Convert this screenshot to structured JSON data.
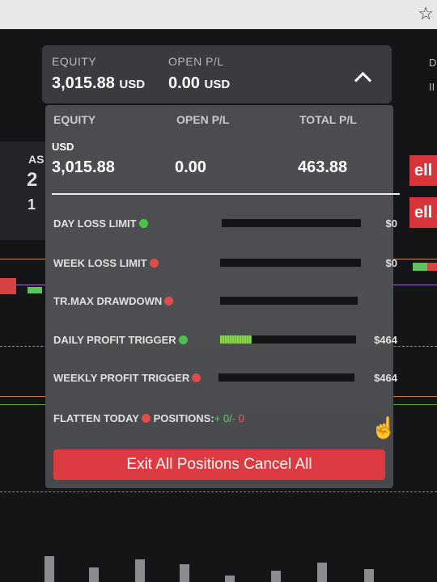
{
  "header": {
    "equity_label": "EQUITY",
    "equity_value": "3,015.88",
    "equity_currency": "USD",
    "open_pl_label": "OPEN P/L",
    "open_pl_value": "0.00",
    "open_pl_currency": "USD",
    "toggle_icon": "chevron-up-icon"
  },
  "panel": {
    "equity_label": "EQUITY",
    "open_pl_label": "OPEN P/L",
    "total_pl_label": "TOTAL P/L",
    "currency": "USD",
    "equity_value": "3,015.88",
    "open_pl_value": "0.00",
    "total_pl_value": "463.88"
  },
  "limits": [
    {
      "label": "DAY LOSS LIMIT",
      "status": "green",
      "progress": 0,
      "amount": "$0"
    },
    {
      "label": "WEEK LOSS LIMIT",
      "status": "red",
      "progress": 0,
      "amount": "$0"
    },
    {
      "label": "TR.MAX DRAWDOWN",
      "status": "red",
      "progress": 0,
      "amount": ""
    },
    {
      "label": "DAILY PROFIT TRIGGER",
      "status": "green",
      "progress": 0.23,
      "amount": "$464"
    },
    {
      "label": "WEEKLY PROFIT TRIGGER",
      "status": "red",
      "progress": 0,
      "amount": "$464"
    }
  ],
  "flatten": {
    "label": "FLATTEN TODAY",
    "status": "red",
    "positions_label": "POSITIONS:",
    "positions_plus": "+ 0/",
    "positions_minus": "- 0"
  },
  "exit_button": "Exit All Positions Cancel All",
  "background": {
    "left_label": "AS",
    "left_big": "2",
    "left_small": "1",
    "sell_1": "ell M",
    "sell_2": "ell A"
  },
  "colors": {
    "accent_red": "#dd3b42",
    "status_green": "#4cc24c",
    "status_red": "#e24b4b",
    "panel_bg": "#4b4c4f"
  }
}
